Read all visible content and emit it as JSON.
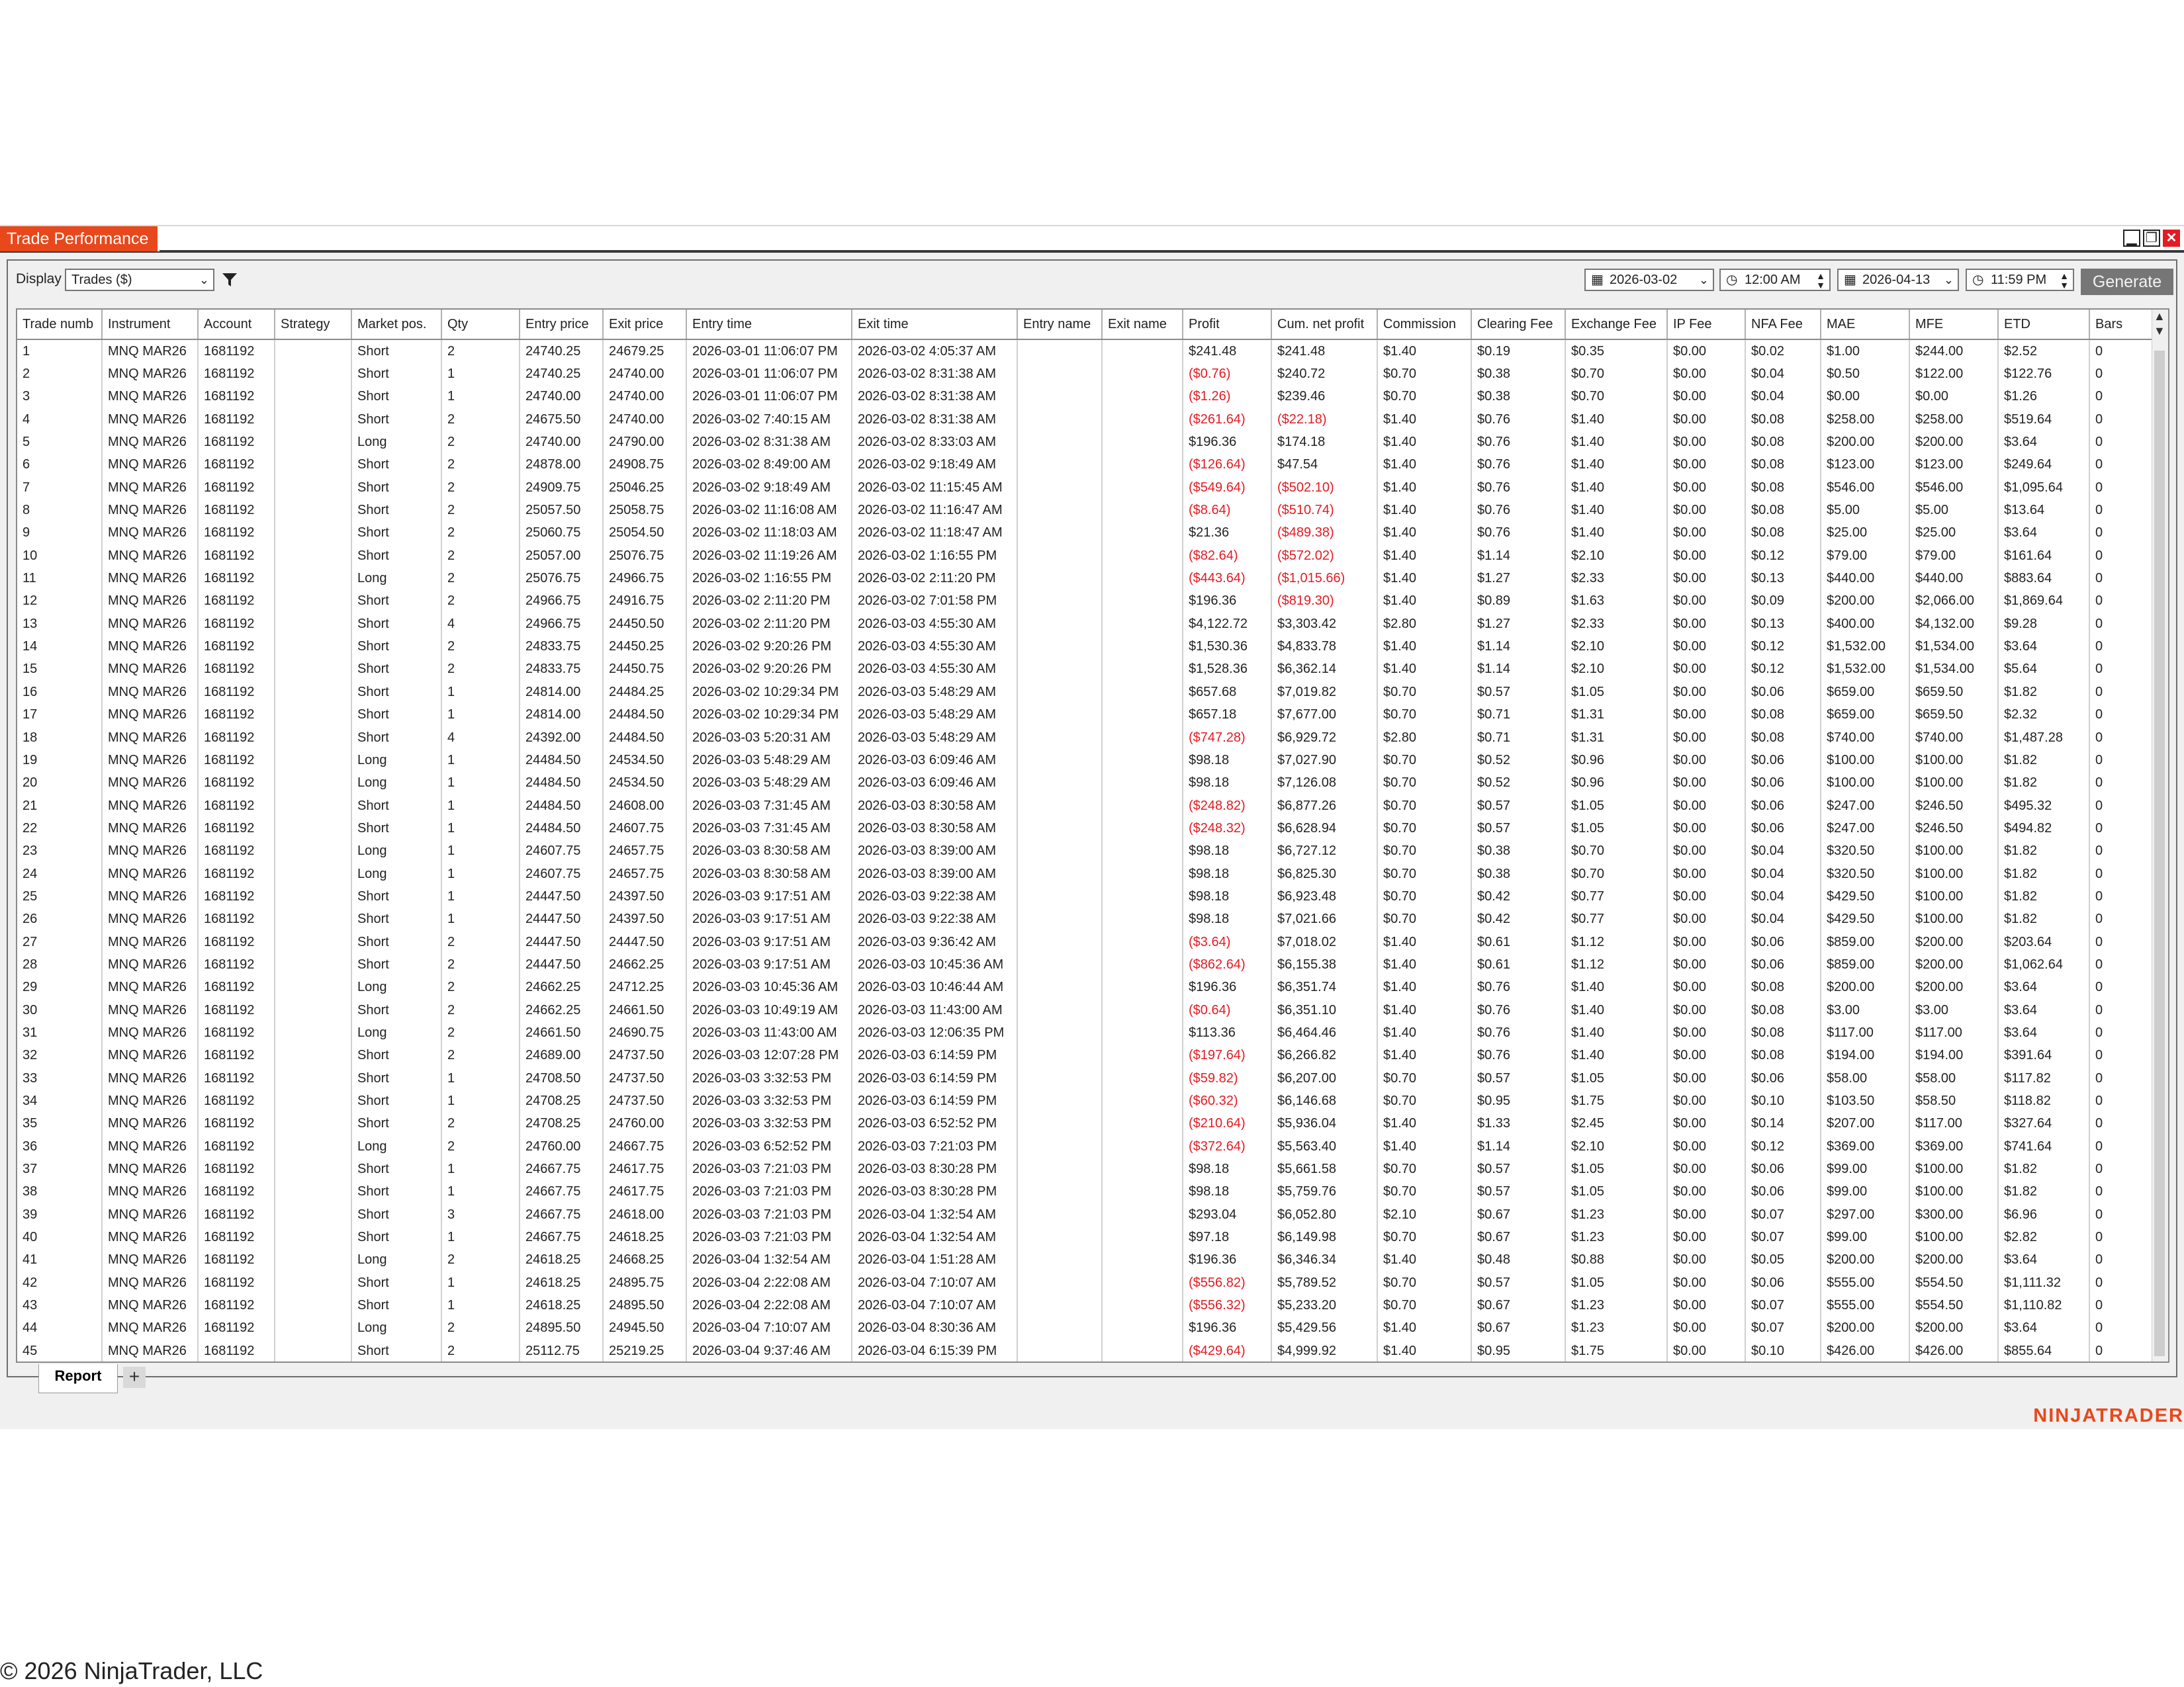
{
  "window": {
    "title": "Trade Performance"
  },
  "toolbar": {
    "display_label": "Display",
    "display_value": "Trades ($)",
    "from_date": "2026-03-02",
    "from_time": "12:00 AM",
    "to_date": "2026-04-13",
    "to_time": "11:59 PM",
    "generate_label": "Generate"
  },
  "columns": [
    "Trade numb",
    "Instrument",
    "Account",
    "Strategy",
    "Market pos.",
    "Qty",
    "Entry price",
    "Exit price",
    "Entry time",
    "Exit time",
    "Entry name",
    "Exit name",
    "Profit",
    "Cum. net profit",
    "Commission",
    "Clearing Fee",
    "Exchange Fee",
    "IP Fee",
    "NFA Fee",
    "MAE",
    "MFE",
    "ETD",
    "Bars"
  ],
  "colors": {
    "accent": "#e8481b",
    "negative": "#e31b23",
    "generate_bg": "#767676"
  },
  "rows": [
    [
      "1",
      "MNQ MAR26",
      "1681192",
      "",
      "Short",
      "2",
      "24740.25",
      "24679.25",
      "2026-03-01 11:06:07 PM",
      "2026-03-02 4:05:37 AM",
      "",
      "",
      "$241.48",
      "$241.48",
      "$1.40",
      "$0.19",
      "$0.35",
      "$0.00",
      "$0.02",
      "$1.00",
      "$244.00",
      "$2.52",
      "0"
    ],
    [
      "2",
      "MNQ MAR26",
      "1681192",
      "",
      "Short",
      "1",
      "24740.25",
      "24740.00",
      "2026-03-01 11:06:07 PM",
      "2026-03-02 8:31:38 AM",
      "",
      "",
      "($0.76)",
      "$240.72",
      "$0.70",
      "$0.38",
      "$0.70",
      "$0.00",
      "$0.04",
      "$0.50",
      "$122.00",
      "$122.76",
      "0"
    ],
    [
      "3",
      "MNQ MAR26",
      "1681192",
      "",
      "Short",
      "1",
      "24740.00",
      "24740.00",
      "2026-03-01 11:06:07 PM",
      "2026-03-02 8:31:38 AM",
      "",
      "",
      "($1.26)",
      "$239.46",
      "$0.70",
      "$0.38",
      "$0.70",
      "$0.00",
      "$0.04",
      "$0.00",
      "$0.00",
      "$1.26",
      "0"
    ],
    [
      "4",
      "MNQ MAR26",
      "1681192",
      "",
      "Short",
      "2",
      "24675.50",
      "24740.00",
      "2026-03-02 7:40:15 AM",
      "2026-03-02 8:31:38 AM",
      "",
      "",
      "($261.64)",
      "($22.18)",
      "$1.40",
      "$0.76",
      "$1.40",
      "$0.00",
      "$0.08",
      "$258.00",
      "$258.00",
      "$519.64",
      "0"
    ],
    [
      "5",
      "MNQ MAR26",
      "1681192",
      "",
      "Long",
      "2",
      "24740.00",
      "24790.00",
      "2026-03-02 8:31:38 AM",
      "2026-03-02 8:33:03 AM",
      "",
      "",
      "$196.36",
      "$174.18",
      "$1.40",
      "$0.76",
      "$1.40",
      "$0.00",
      "$0.08",
      "$200.00",
      "$200.00",
      "$3.64",
      "0"
    ],
    [
      "6",
      "MNQ MAR26",
      "1681192",
      "",
      "Short",
      "2",
      "24878.00",
      "24908.75",
      "2026-03-02 8:49:00 AM",
      "2026-03-02 9:18:49 AM",
      "",
      "",
      "($126.64)",
      "$47.54",
      "$1.40",
      "$0.76",
      "$1.40",
      "$0.00",
      "$0.08",
      "$123.00",
      "$123.00",
      "$249.64",
      "0"
    ],
    [
      "7",
      "MNQ MAR26",
      "1681192",
      "",
      "Short",
      "2",
      "24909.75",
      "25046.25",
      "2026-03-02 9:18:49 AM",
      "2026-03-02 11:15:45 AM",
      "",
      "",
      "($549.64)",
      "($502.10)",
      "$1.40",
      "$0.76",
      "$1.40",
      "$0.00",
      "$0.08",
      "$546.00",
      "$546.00",
      "$1,095.64",
      "0"
    ],
    [
      "8",
      "MNQ MAR26",
      "1681192",
      "",
      "Short",
      "2",
      "25057.50",
      "25058.75",
      "2026-03-02 11:16:08 AM",
      "2026-03-02 11:16:47 AM",
      "",
      "",
      "($8.64)",
      "($510.74)",
      "$1.40",
      "$0.76",
      "$1.40",
      "$0.00",
      "$0.08",
      "$5.00",
      "$5.00",
      "$13.64",
      "0"
    ],
    [
      "9",
      "MNQ MAR26",
      "1681192",
      "",
      "Short",
      "2",
      "25060.75",
      "25054.50",
      "2026-03-02 11:18:03 AM",
      "2026-03-02 11:18:47 AM",
      "",
      "",
      "$21.36",
      "($489.38)",
      "$1.40",
      "$0.76",
      "$1.40",
      "$0.00",
      "$0.08",
      "$25.00",
      "$25.00",
      "$3.64",
      "0"
    ],
    [
      "10",
      "MNQ MAR26",
      "1681192",
      "",
      "Short",
      "2",
      "25057.00",
      "25076.75",
      "2026-03-02 11:19:26 AM",
      "2026-03-02 1:16:55 PM",
      "",
      "",
      "($82.64)",
      "($572.02)",
      "$1.40",
      "$1.14",
      "$2.10",
      "$0.00",
      "$0.12",
      "$79.00",
      "$79.00",
      "$161.64",
      "0"
    ],
    [
      "11",
      "MNQ MAR26",
      "1681192",
      "",
      "Long",
      "2",
      "25076.75",
      "24966.75",
      "2026-03-02 1:16:55 PM",
      "2026-03-02 2:11:20 PM",
      "",
      "",
      "($443.64)",
      "($1,015.66)",
      "$1.40",
      "$1.27",
      "$2.33",
      "$0.00",
      "$0.13",
      "$440.00",
      "$440.00",
      "$883.64",
      "0"
    ],
    [
      "12",
      "MNQ MAR26",
      "1681192",
      "",
      "Short",
      "2",
      "24966.75",
      "24916.75",
      "2026-03-02 2:11:20 PM",
      "2026-03-02 7:01:58 PM",
      "",
      "",
      "$196.36",
      "($819.30)",
      "$1.40",
      "$0.89",
      "$1.63",
      "$0.00",
      "$0.09",
      "$200.00",
      "$2,066.00",
      "$1,869.64",
      "0"
    ],
    [
      "13",
      "MNQ MAR26",
      "1681192",
      "",
      "Short",
      "4",
      "24966.75",
      "24450.50",
      "2026-03-02 2:11:20 PM",
      "2026-03-03 4:55:30 AM",
      "",
      "",
      "$4,122.72",
      "$3,303.42",
      "$2.80",
      "$1.27",
      "$2.33",
      "$0.00",
      "$0.13",
      "$400.00",
      "$4,132.00",
      "$9.28",
      "0"
    ],
    [
      "14",
      "MNQ MAR26",
      "1681192",
      "",
      "Short",
      "2",
      "24833.75",
      "24450.25",
      "2026-03-02 9:20:26 PM",
      "2026-03-03 4:55:30 AM",
      "",
      "",
      "$1,530.36",
      "$4,833.78",
      "$1.40",
      "$1.14",
      "$2.10",
      "$0.00",
      "$0.12",
      "$1,532.00",
      "$1,534.00",
      "$3.64",
      "0"
    ],
    [
      "15",
      "MNQ MAR26",
      "1681192",
      "",
      "Short",
      "2",
      "24833.75",
      "24450.75",
      "2026-03-02 9:20:26 PM",
      "2026-03-03 4:55:30 AM",
      "",
      "",
      "$1,528.36",
      "$6,362.14",
      "$1.40",
      "$1.14",
      "$2.10",
      "$0.00",
      "$0.12",
      "$1,532.00",
      "$1,534.00",
      "$5.64",
      "0"
    ],
    [
      "16",
      "MNQ MAR26",
      "1681192",
      "",
      "Short",
      "1",
      "24814.00",
      "24484.25",
      "2026-03-02 10:29:34 PM",
      "2026-03-03 5:48:29 AM",
      "",
      "",
      "$657.68",
      "$7,019.82",
      "$0.70",
      "$0.57",
      "$1.05",
      "$0.00",
      "$0.06",
      "$659.00",
      "$659.50",
      "$1.82",
      "0"
    ],
    [
      "17",
      "MNQ MAR26",
      "1681192",
      "",
      "Short",
      "1",
      "24814.00",
      "24484.50",
      "2026-03-02 10:29:34 PM",
      "2026-03-03 5:48:29 AM",
      "",
      "",
      "$657.18",
      "$7,677.00",
      "$0.70",
      "$0.71",
      "$1.31",
      "$0.00",
      "$0.08",
      "$659.00",
      "$659.50",
      "$2.32",
      "0"
    ],
    [
      "18",
      "MNQ MAR26",
      "1681192",
      "",
      "Short",
      "4",
      "24392.00",
      "24484.50",
      "2026-03-03 5:20:31 AM",
      "2026-03-03 5:48:29 AM",
      "",
      "",
      "($747.28)",
      "$6,929.72",
      "$2.80",
      "$0.71",
      "$1.31",
      "$0.00",
      "$0.08",
      "$740.00",
      "$740.00",
      "$1,487.28",
      "0"
    ],
    [
      "19",
      "MNQ MAR26",
      "1681192",
      "",
      "Long",
      "1",
      "24484.50",
      "24534.50",
      "2026-03-03 5:48:29 AM",
      "2026-03-03 6:09:46 AM",
      "",
      "",
      "$98.18",
      "$7,027.90",
      "$0.70",
      "$0.52",
      "$0.96",
      "$0.00",
      "$0.06",
      "$100.00",
      "$100.00",
      "$1.82",
      "0"
    ],
    [
      "20",
      "MNQ MAR26",
      "1681192",
      "",
      "Long",
      "1",
      "24484.50",
      "24534.50",
      "2026-03-03 5:48:29 AM",
      "2026-03-03 6:09:46 AM",
      "",
      "",
      "$98.18",
      "$7,126.08",
      "$0.70",
      "$0.52",
      "$0.96",
      "$0.00",
      "$0.06",
      "$100.00",
      "$100.00",
      "$1.82",
      "0"
    ],
    [
      "21",
      "MNQ MAR26",
      "1681192",
      "",
      "Short",
      "1",
      "24484.50",
      "24608.00",
      "2026-03-03 7:31:45 AM",
      "2026-03-03 8:30:58 AM",
      "",
      "",
      "($248.82)",
      "$6,877.26",
      "$0.70",
      "$0.57",
      "$1.05",
      "$0.00",
      "$0.06",
      "$247.00",
      "$246.50",
      "$495.32",
      "0"
    ],
    [
      "22",
      "MNQ MAR26",
      "1681192",
      "",
      "Short",
      "1",
      "24484.50",
      "24607.75",
      "2026-03-03 7:31:45 AM",
      "2026-03-03 8:30:58 AM",
      "",
      "",
      "($248.32)",
      "$6,628.94",
      "$0.70",
      "$0.57",
      "$1.05",
      "$0.00",
      "$0.06",
      "$247.00",
      "$246.50",
      "$494.82",
      "0"
    ],
    [
      "23",
      "MNQ MAR26",
      "1681192",
      "",
      "Long",
      "1",
      "24607.75",
      "24657.75",
      "2026-03-03 8:30:58 AM",
      "2026-03-03 8:39:00 AM",
      "",
      "",
      "$98.18",
      "$6,727.12",
      "$0.70",
      "$0.38",
      "$0.70",
      "$0.00",
      "$0.04",
      "$320.50",
      "$100.00",
      "$1.82",
      "0"
    ],
    [
      "24",
      "MNQ MAR26",
      "1681192",
      "",
      "Long",
      "1",
      "24607.75",
      "24657.75",
      "2026-03-03 8:30:58 AM",
      "2026-03-03 8:39:00 AM",
      "",
      "",
      "$98.18",
      "$6,825.30",
      "$0.70",
      "$0.38",
      "$0.70",
      "$0.00",
      "$0.04",
      "$320.50",
      "$100.00",
      "$1.82",
      "0"
    ],
    [
      "25",
      "MNQ MAR26",
      "1681192",
      "",
      "Short",
      "1",
      "24447.50",
      "24397.50",
      "2026-03-03 9:17:51 AM",
      "2026-03-03 9:22:38 AM",
      "",
      "",
      "$98.18",
      "$6,923.48",
      "$0.70",
      "$0.42",
      "$0.77",
      "$0.00",
      "$0.04",
      "$429.50",
      "$100.00",
      "$1.82",
      "0"
    ],
    [
      "26",
      "MNQ MAR26",
      "1681192",
      "",
      "Short",
      "1",
      "24447.50",
      "24397.50",
      "2026-03-03 9:17:51 AM",
      "2026-03-03 9:22:38 AM",
      "",
      "",
      "$98.18",
      "$7,021.66",
      "$0.70",
      "$0.42",
      "$0.77",
      "$0.00",
      "$0.04",
      "$429.50",
      "$100.00",
      "$1.82",
      "0"
    ],
    [
      "27",
      "MNQ MAR26",
      "1681192",
      "",
      "Short",
      "2",
      "24447.50",
      "24447.50",
      "2026-03-03 9:17:51 AM",
      "2026-03-03 9:36:42 AM",
      "",
      "",
      "($3.64)",
      "$7,018.02",
      "$1.40",
      "$0.61",
      "$1.12",
      "$0.00",
      "$0.06",
      "$859.00",
      "$200.00",
      "$203.64",
      "0"
    ],
    [
      "28",
      "MNQ MAR26",
      "1681192",
      "",
      "Short",
      "2",
      "24447.50",
      "24662.25",
      "2026-03-03 9:17:51 AM",
      "2026-03-03 10:45:36 AM",
      "",
      "",
      "($862.64)",
      "$6,155.38",
      "$1.40",
      "$0.61",
      "$1.12",
      "$0.00",
      "$0.06",
      "$859.00",
      "$200.00",
      "$1,062.64",
      "0"
    ],
    [
      "29",
      "MNQ MAR26",
      "1681192",
      "",
      "Long",
      "2",
      "24662.25",
      "24712.25",
      "2026-03-03 10:45:36 AM",
      "2026-03-03 10:46:44 AM",
      "",
      "",
      "$196.36",
      "$6,351.74",
      "$1.40",
      "$0.76",
      "$1.40",
      "$0.00",
      "$0.08",
      "$200.00",
      "$200.00",
      "$3.64",
      "0"
    ],
    [
      "30",
      "MNQ MAR26",
      "1681192",
      "",
      "Short",
      "2",
      "24662.25",
      "24661.50",
      "2026-03-03 10:49:19 AM",
      "2026-03-03 11:43:00 AM",
      "",
      "",
      "($0.64)",
      "$6,351.10",
      "$1.40",
      "$0.76",
      "$1.40",
      "$0.00",
      "$0.08",
      "$3.00",
      "$3.00",
      "$3.64",
      "0"
    ],
    [
      "31",
      "MNQ MAR26",
      "1681192",
      "",
      "Long",
      "2",
      "24661.50",
      "24690.75",
      "2026-03-03 11:43:00 AM",
      "2026-03-03 12:06:35 PM",
      "",
      "",
      "$113.36",
      "$6,464.46",
      "$1.40",
      "$0.76",
      "$1.40",
      "$0.00",
      "$0.08",
      "$117.00",
      "$117.00",
      "$3.64",
      "0"
    ],
    [
      "32",
      "MNQ MAR26",
      "1681192",
      "",
      "Short",
      "2",
      "24689.00",
      "24737.50",
      "2026-03-03 12:07:28 PM",
      "2026-03-03 6:14:59 PM",
      "",
      "",
      "($197.64)",
      "$6,266.82",
      "$1.40",
      "$0.76",
      "$1.40",
      "$0.00",
      "$0.08",
      "$194.00",
      "$194.00",
      "$391.64",
      "0"
    ],
    [
      "33",
      "MNQ MAR26",
      "1681192",
      "",
      "Short",
      "1",
      "24708.50",
      "24737.50",
      "2026-03-03 3:32:53 PM",
      "2026-03-03 6:14:59 PM",
      "",
      "",
      "($59.82)",
      "$6,207.00",
      "$0.70",
      "$0.57",
      "$1.05",
      "$0.00",
      "$0.06",
      "$58.00",
      "$58.00",
      "$117.82",
      "0"
    ],
    [
      "34",
      "MNQ MAR26",
      "1681192",
      "",
      "Short",
      "1",
      "24708.25",
      "24737.50",
      "2026-03-03 3:32:53 PM",
      "2026-03-03 6:14:59 PM",
      "",
      "",
      "($60.32)",
      "$6,146.68",
      "$0.70",
      "$0.95",
      "$1.75",
      "$0.00",
      "$0.10",
      "$103.50",
      "$58.50",
      "$118.82",
      "0"
    ],
    [
      "35",
      "MNQ MAR26",
      "1681192",
      "",
      "Short",
      "2",
      "24708.25",
      "24760.00",
      "2026-03-03 3:32:53 PM",
      "2026-03-03 6:52:52 PM",
      "",
      "",
      "($210.64)",
      "$5,936.04",
      "$1.40",
      "$1.33",
      "$2.45",
      "$0.00",
      "$0.14",
      "$207.00",
      "$117.00",
      "$327.64",
      "0"
    ],
    [
      "36",
      "MNQ MAR26",
      "1681192",
      "",
      "Long",
      "2",
      "24760.00",
      "24667.75",
      "2026-03-03 6:52:52 PM",
      "2026-03-03 7:21:03 PM",
      "",
      "",
      "($372.64)",
      "$5,563.40",
      "$1.40",
      "$1.14",
      "$2.10",
      "$0.00",
      "$0.12",
      "$369.00",
      "$369.00",
      "$741.64",
      "0"
    ],
    [
      "37",
      "MNQ MAR26",
      "1681192",
      "",
      "Short",
      "1",
      "24667.75",
      "24617.75",
      "2026-03-03 7:21:03 PM",
      "2026-03-03 8:30:28 PM",
      "",
      "",
      "$98.18",
      "$5,661.58",
      "$0.70",
      "$0.57",
      "$1.05",
      "$0.00",
      "$0.06",
      "$99.00",
      "$100.00",
      "$1.82",
      "0"
    ],
    [
      "38",
      "MNQ MAR26",
      "1681192",
      "",
      "Short",
      "1",
      "24667.75",
      "24617.75",
      "2026-03-03 7:21:03 PM",
      "2026-03-03 8:30:28 PM",
      "",
      "",
      "$98.18",
      "$5,759.76",
      "$0.70",
      "$0.57",
      "$1.05",
      "$0.00",
      "$0.06",
      "$99.00",
      "$100.00",
      "$1.82",
      "0"
    ],
    [
      "39",
      "MNQ MAR26",
      "1681192",
      "",
      "Short",
      "3",
      "24667.75",
      "24618.00",
      "2026-03-03 7:21:03 PM",
      "2026-03-04 1:32:54 AM",
      "",
      "",
      "$293.04",
      "$6,052.80",
      "$2.10",
      "$0.67",
      "$1.23",
      "$0.00",
      "$0.07",
      "$297.00",
      "$300.00",
      "$6.96",
      "0"
    ],
    [
      "40",
      "MNQ MAR26",
      "1681192",
      "",
      "Short",
      "1",
      "24667.75",
      "24618.25",
      "2026-03-03 7:21:03 PM",
      "2026-03-04 1:32:54 AM",
      "",
      "",
      "$97.18",
      "$6,149.98",
      "$0.70",
      "$0.67",
      "$1.23",
      "$0.00",
      "$0.07",
      "$99.00",
      "$100.00",
      "$2.82",
      "0"
    ],
    [
      "41",
      "MNQ MAR26",
      "1681192",
      "",
      "Long",
      "2",
      "24618.25",
      "24668.25",
      "2026-03-04 1:32:54 AM",
      "2026-03-04 1:51:28 AM",
      "",
      "",
      "$196.36",
      "$6,346.34",
      "$1.40",
      "$0.48",
      "$0.88",
      "$0.00",
      "$0.05",
      "$200.00",
      "$200.00",
      "$3.64",
      "0"
    ],
    [
      "42",
      "MNQ MAR26",
      "1681192",
      "",
      "Short",
      "1",
      "24618.25",
      "24895.75",
      "2026-03-04 2:22:08 AM",
      "2026-03-04 7:10:07 AM",
      "",
      "",
      "($556.82)",
      "$5,789.52",
      "$0.70",
      "$0.57",
      "$1.05",
      "$0.00",
      "$0.06",
      "$555.00",
      "$554.50",
      "$1,111.32",
      "0"
    ],
    [
      "43",
      "MNQ MAR26",
      "1681192",
      "",
      "Short",
      "1",
      "24618.25",
      "24895.50",
      "2026-03-04 2:22:08 AM",
      "2026-03-04 7:10:07 AM",
      "",
      "",
      "($556.32)",
      "$5,233.20",
      "$0.70",
      "$0.67",
      "$1.23",
      "$0.00",
      "$0.07",
      "$555.00",
      "$554.50",
      "$1,110.82",
      "0"
    ],
    [
      "44",
      "MNQ MAR26",
      "1681192",
      "",
      "Long",
      "2",
      "24895.50",
      "24945.50",
      "2026-03-04 7:10:07 AM",
      "2026-03-04 8:30:36 AM",
      "",
      "",
      "$196.36",
      "$5,429.56",
      "$1.40",
      "$0.67",
      "$1.23",
      "$0.00",
      "$0.07",
      "$200.00",
      "$200.00",
      "$3.64",
      "0"
    ],
    [
      "45",
      "MNQ MAR26",
      "1681192",
      "",
      "Short",
      "2",
      "25112.75",
      "25219.25",
      "2026-03-04 9:37:46 AM",
      "2026-03-04 6:15:39 PM",
      "",
      "",
      "($429.64)",
      "$4,999.92",
      "$1.40",
      "$0.95",
      "$1.75",
      "$0.00",
      "$0.10",
      "$426.00",
      "$426.00",
      "$855.64",
      "0"
    ]
  ],
  "tabs": {
    "report_label": "Report",
    "add_label": "+"
  },
  "branding": {
    "logo_text": "NINJATRADER",
    "copyright": "© 2026 NinjaTrader, LLC"
  }
}
